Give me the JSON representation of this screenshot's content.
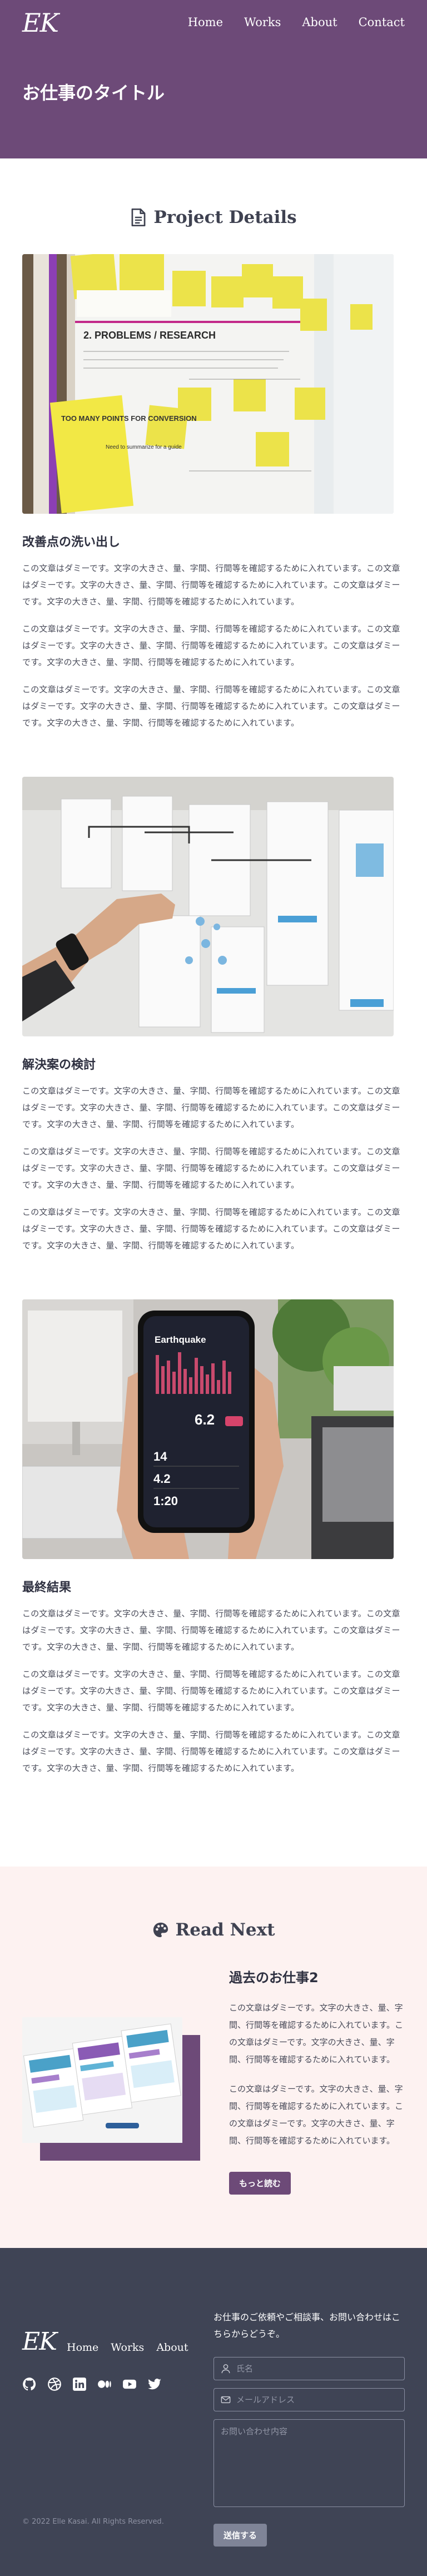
{
  "site": {
    "logo": "EK",
    "nav": [
      "Home",
      "Works",
      "About",
      "Contact"
    ]
  },
  "hero": {
    "title": "お仕事のタイトル"
  },
  "details": {
    "heading": "Project Details",
    "heading_icon": "document-icon",
    "blocks": [
      {
        "title": "改善点の洗い出し",
        "paragraphs": [
          "この文章はダミーです。文字の大きさ、量、字間、行間等を確認するために入れています。この文章はダミーです。文字の大きさ、量、字間、行間等を確認するために入れています。この文章はダミーです。文字の大きさ、量、字間、行間等を確認するために入れています。",
          "この文章はダミーです。文字の大きさ、量、字間、行間等を確認するために入れています。この文章はダミーです。文字の大きさ、量、字間、行間等を確認するために入れています。この文章はダミーです。文字の大きさ、量、字間、行間等を確認するために入れています。",
          "この文章はダミーです。文字の大きさ、量、字間、行間等を確認するために入れています。この文章はダミーです。文字の大きさ、量、字間、行間等を確認するために入れています。この文章はダミーです。文字の大きさ、量、字間、行間等を確認するために入れています。"
        ]
      },
      {
        "title": "解決案の検討",
        "paragraphs": [
          "この文章はダミーです。文字の大きさ、量、字間、行間等を確認するために入れています。この文章はダミーです。文字の大きさ、量、字間、行間等を確認するために入れています。この文章はダミーです。文字の大きさ、量、字間、行間等を確認するために入れています。",
          "この文章はダミーです。文字の大きさ、量、字間、行間等を確認するために入れています。この文章はダミーです。文字の大きさ、量、字間、行間等を確認するために入れています。この文章はダミーです。文字の大きさ、量、字間、行間等を確認するために入れています。",
          "この文章はダミーです。文字の大きさ、量、字間、行間等を確認するために入れています。この文章はダミーです。文字の大きさ、量、字間、行間等を確認するために入れています。この文章はダミーです。文字の大きさ、量、字間、行間等を確認するために入れています。"
        ]
      },
      {
        "title": "最終結果",
        "paragraphs": [
          "この文章はダミーです。文字の大きさ、量、字間、行間等を確認するために入れています。この文章はダミーです。文字の大きさ、量、字間、行間等を確認するために入れています。この文章はダミーです。文字の大きさ、量、字間、行間等を確認するために入れています。",
          "この文章はダミーです。文字の大きさ、量、字間、行間等を確認するために入れています。この文章はダミーです。文字の大きさ、量、字間、行間等を確認するために入れています。この文章はダミーです。文字の大きさ、量、字間、行間等を確認するために入れています。",
          "この文章はダミーです。文字の大きさ、量、字間、行間等を確認するために入れています。この文章はダミーです。文字の大きさ、量、字間、行間等を確認するために入れています。この文章はダミーです。文字の大きさ、量、字間、行間等を確認するために入れています。"
        ]
      }
    ],
    "sticky_notes": [
      "2. PROBLEMS / RESEARCH",
      "TOO MANY POINTS FOR CONVERSION",
      "Need to summarize for a guide"
    ],
    "phone": {
      "app_title": "Earthquake",
      "stats": [
        "6.2",
        "14",
        "4.2",
        "1:20"
      ]
    }
  },
  "readnext": {
    "heading": "Read Next",
    "heading_icon": "palette-icon",
    "title": "過去のお仕事2",
    "paragraphs": [
      "この文章はダミーです。文字の大きさ、量、字間、行間等を確認するために入れています。この文章はダミーです。文字の大きさ、量、字間、行間等を確認するために入れています。",
      "この文章はダミーです。文字の大きさ、量、字間、行間等を確認するために入れています。この文章はダミーです。文字の大きさ、量、字間、行間等を確認するために入れています。"
    ],
    "button": "もっと読む"
  },
  "footer": {
    "logo": "EK",
    "nav": [
      "Home",
      "Works",
      "About"
    ],
    "social_icons": [
      "github-icon",
      "dribbble-icon",
      "linkedin-icon",
      "medium-icon",
      "youtube-icon",
      "twitter-icon"
    ],
    "copyright": "© 2022 Elle Kasai. All Rights Reserved.",
    "contact_lead": "お仕事のご依頼やご相談事、お問い合わせはこちらからどうぞ。",
    "name_placeholder": "氏名",
    "email_placeholder": "メールアドレス",
    "message_placeholder": "お問い合わせ内容",
    "submit": "送信する"
  },
  "colors": {
    "brand": "#6d4a78",
    "footer_bg": "#3f4455",
    "readnext_bg": "#fdf2f1",
    "text": "#3f4251"
  }
}
